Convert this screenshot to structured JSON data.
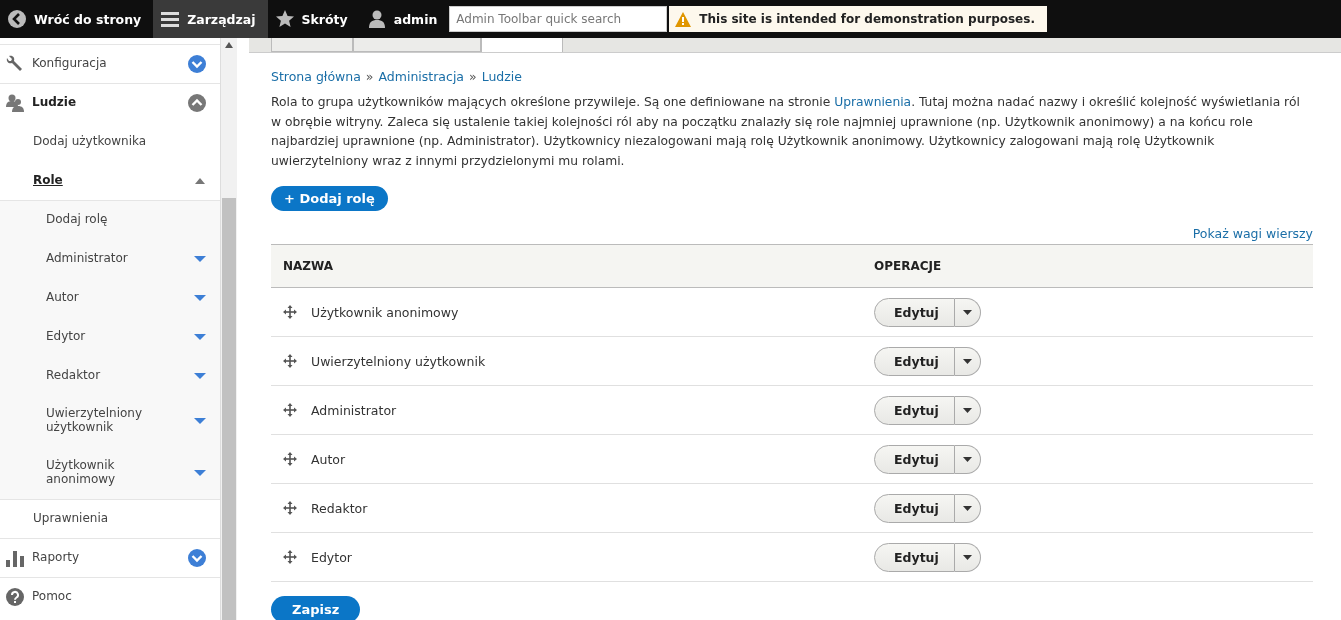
{
  "toolbar": {
    "items": [
      {
        "label": "Wróć do strony",
        "selected": false
      },
      {
        "label": "Zarządzaj",
        "selected": true
      },
      {
        "label": "Skróty",
        "selected": false
      },
      {
        "label": "admin",
        "selected": false
      }
    ],
    "search": {
      "placeholder": "Admin Toolbar quick search"
    },
    "notice": "This site is intended for demonstration purposes."
  },
  "sidebar": {
    "items": [
      {
        "label": "Konfiguracja",
        "expanded": false
      },
      {
        "label": "Ludzie",
        "expanded": true,
        "children": [
          {
            "label": "Dodaj użytkownika",
            "selected": false
          },
          {
            "label": "Role",
            "selected": true,
            "expanded": true,
            "children": [
              {
                "label": "Dodaj rolę"
              },
              {
                "label": "Administrator",
                "expanded": false
              },
              {
                "label": "Autor",
                "expanded": false
              },
              {
                "label": "Edytor",
                "expanded": false
              },
              {
                "label": "Redaktor",
                "expanded": false
              },
              {
                "label": "Uwierzytelniony użytkownik",
                "expanded": false
              },
              {
                "label": "Użytkownik anonimowy",
                "expanded": false
              }
            ]
          },
          {
            "label": "Uprawnienia",
            "selected": false
          }
        ]
      },
      {
        "label": "Raporty",
        "expanded": false
      },
      {
        "label": "Pomoc"
      }
    ]
  },
  "tabs": [
    {
      "selected": false
    },
    {
      "selected": false
    },
    {
      "selected": true
    }
  ],
  "breadcrumb": {
    "separator": "»",
    "items": [
      "Strona główna",
      "Administracja",
      "Ludzie"
    ]
  },
  "description": {
    "before": "Rola to grupa użytkowników mających określone przywileje. Są one definiowane na stronie ",
    "link": "Uprawnienia",
    "after": ". Tutaj można nadać nazwy i określić kolejność wyświetlania ról w obrębie witryny. Zaleca się ustalenie takiej kolejności ról aby na początku znalazły się role najmniej uprawnione (np. Użytkownik anonimowy) a na końcu role najbardziej uprawnione (np. Administrator). Użytkownicy niezalogowani mają rolę Użytkownik anonimowy. Użytkownicy zalogowani mają rolę Użytkownik uwierzytelniony wraz z innymi przydzielonymi mu rolami."
  },
  "add_button": "+ Dodaj rolę",
  "weights_link": "Pokaż wagi wierszy",
  "table": {
    "columns": [
      "NAZWA",
      "OPERACJE"
    ],
    "rows": [
      {
        "name": "Użytkownik anonimowy",
        "action": "Edytuj"
      },
      {
        "name": "Uwierzytelniony użytkownik",
        "action": "Edytuj"
      },
      {
        "name": "Administrator",
        "action": "Edytuj"
      },
      {
        "name": "Autor",
        "action": "Edytuj"
      },
      {
        "name": "Redaktor",
        "action": "Edytuj"
      },
      {
        "name": "Edytor",
        "action": "Edytuj"
      }
    ]
  },
  "save_button": "Zapisz"
}
